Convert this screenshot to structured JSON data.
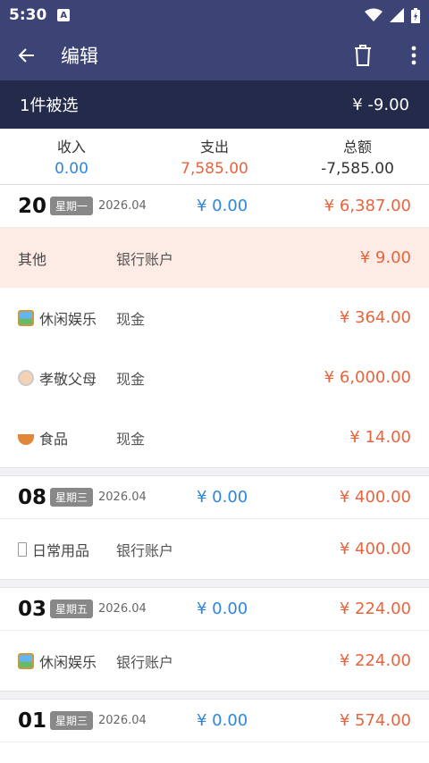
{
  "status": {
    "time": "5:30",
    "notify_letter": "A"
  },
  "appbar": {
    "title": "编辑"
  },
  "selection": {
    "count_text": "1件被选",
    "amount": "¥ -9.00"
  },
  "summary": {
    "income_label": "收入",
    "income": "0.00",
    "expense_label": "支出",
    "expense": "7,585.00",
    "total_label": "总额",
    "total": "-7,585.00"
  },
  "days": [
    {
      "day": "20",
      "weekday": "星期一",
      "ym": "2026.04",
      "income": "¥ 0.00",
      "expense": "¥ 6,387.00",
      "rows": [
        {
          "cat": "其他",
          "icon": "none",
          "account": "银行账户",
          "amount": "¥ 9.00",
          "selected": true
        },
        {
          "cat": "休闲娱乐",
          "icon": "picture-icon",
          "account": "现金",
          "amount": "¥ 364.00"
        },
        {
          "cat": "孝敬父母",
          "icon": "elder-face-icon",
          "account": "现金",
          "amount": "¥ 6,000.00"
        },
        {
          "cat": "食品",
          "icon": "noodle-bowl-icon",
          "account": "现金",
          "amount": "¥ 14.00"
        }
      ]
    },
    {
      "day": "08",
      "weekday": "星期三",
      "ym": "2026.04",
      "income": "¥ 0.00",
      "expense": "¥ 400.00",
      "rows": [
        {
          "cat": "日常用品",
          "icon": "placeholder-icon",
          "account": "银行账户",
          "amount": "¥ 400.00"
        }
      ]
    },
    {
      "day": "03",
      "weekday": "星期五",
      "ym": "2026.04",
      "income": "¥ 0.00",
      "expense": "¥ 224.00",
      "rows": [
        {
          "cat": "休闲娱乐",
          "icon": "picture-icon",
          "account": "银行账户",
          "amount": "¥ 224.00"
        }
      ]
    },
    {
      "day": "01",
      "weekday": "星期三",
      "ym": "2026.04",
      "income": "¥ 0.00",
      "expense": "¥ 574.00",
      "rows": []
    }
  ]
}
